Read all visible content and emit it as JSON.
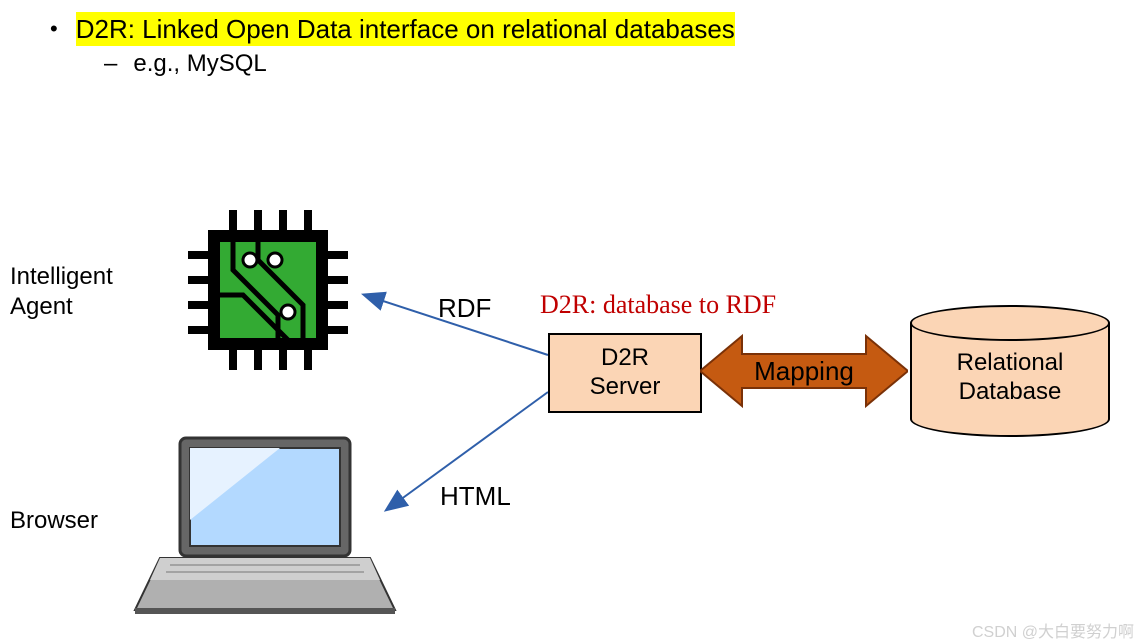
{
  "bullet": {
    "main": "D2R: Linked Open Data interface on relational databases",
    "sub_prefix": "–",
    "sub_text": "e.g., MySQL"
  },
  "labels": {
    "intelligent_agent": "Intelligent\nAgent",
    "browser": "Browser",
    "rdf": "RDF",
    "html": "HTML",
    "d2r_meaning": "D2R: database to RDF"
  },
  "boxes": {
    "d2r_server": "D2R\nServer",
    "mapping": "Mapping",
    "database": "Relational\nDatabase"
  },
  "icons": {
    "chip": "chip-icon",
    "laptop": "laptop-icon",
    "arrow_rdf": "arrow-icon",
    "arrow_html": "arrow-icon",
    "double_arrow": "double-arrow-icon",
    "cylinder": "database-cylinder-icon"
  },
  "colors": {
    "highlight": "#ffff00",
    "box_fill": "#fbd5b5",
    "arrow_blue": "#2f5faa",
    "mapping_fill": "#c55a11",
    "chip_green": "#339933",
    "d2r_red": "#c00000"
  },
  "watermark": "CSDN @大白要努力啊"
}
